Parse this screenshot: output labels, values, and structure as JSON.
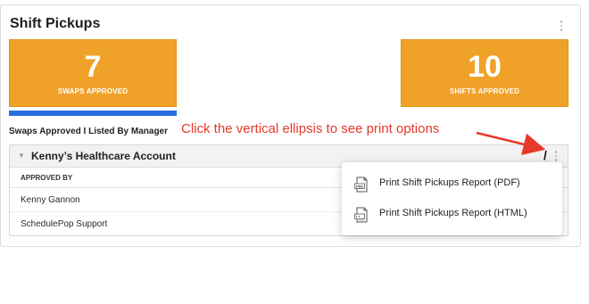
{
  "panel": {
    "title": "Shift Pickups"
  },
  "stats": [
    {
      "value": "7",
      "label": "SWAPS APPROVED"
    },
    {
      "value": "10",
      "label": "SHIFTS APPROVED"
    }
  ],
  "section_label": "Swaps Approved I Listed By Manager",
  "annotation": "Click the vertical ellipsis to see print options",
  "account": {
    "name": "Kenny’s Healthcare Account",
    "slash": "/",
    "column_header": "APPROVED BY",
    "rows": [
      "Kenny Gannon",
      "SchedulePop Support"
    ]
  },
  "menu": {
    "items": [
      {
        "label": "Print Shift Pickups Report (PDF)",
        "icon": "pdf-file-icon"
      },
      {
        "label": "Print Shift Pickups Report (HTML)",
        "icon": "html-file-icon"
      }
    ]
  },
  "colors": {
    "accent": "#f0a128",
    "bar": "#2a6fe0",
    "annotation": "#e8382a"
  }
}
